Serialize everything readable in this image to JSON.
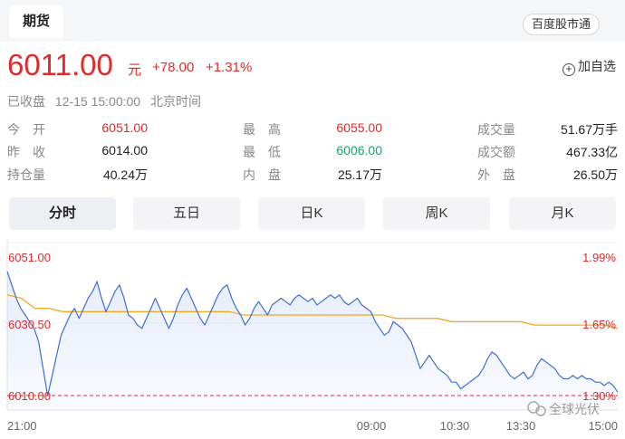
{
  "header": {
    "tab_label": "期货",
    "brand_button": "百度股市通"
  },
  "quote": {
    "price": "6011.00",
    "unit": "元",
    "change": "+78.00",
    "change_pct": "+1.31%",
    "watch_label": "加自选",
    "status": "已收盘",
    "time": "12-15 15:00:00",
    "timezone": "北京时间"
  },
  "stats": {
    "open_label": "今　开",
    "open": "6051.00",
    "prev_close_label": "昨　收",
    "prev_close": "6014.00",
    "open_interest_label": "持仓量",
    "open_interest": "40.24万",
    "high_label": "最　高",
    "high": "6055.00",
    "low_label": "最　低",
    "low": "6006.00",
    "inner_label": "内　盘",
    "inner": "25.17万",
    "volume_label": "成交量",
    "volume": "51.67万手",
    "amount_label": "成交额",
    "amount": "467.33亿",
    "outer_label": "外　盘",
    "outer": "26.50万"
  },
  "period_tabs": [
    "分时",
    "五日",
    "日K",
    "周K",
    "月K"
  ],
  "colors": {
    "up": "#e22a2a",
    "down": "#1aa36b",
    "price_line": "#3b6fd8",
    "avg_line": "#f5a623"
  },
  "watermark": "全球光伏",
  "chart_data": {
    "type": "line",
    "y_labels": [
      "6051.00",
      "6030.50",
      "6010.00"
    ],
    "pct_labels": [
      "1.99%",
      "1.65%",
      "1.30%"
    ],
    "x_labels": [
      "21:00",
      "09:00",
      "10:30",
      "13:30",
      "15:00"
    ],
    "ylim": [
      6010,
      6051
    ],
    "series": [
      {
        "values": [
          6047,
          6043,
          6039,
          6036,
          6034,
          6032,
          6030,
          6026,
          6018,
          6010,
          6016,
          6022,
          6028,
          6031,
          6034,
          6036,
          6033,
          6036,
          6039,
          6041,
          6044,
          6039,
          6035,
          6038,
          6041,
          6043,
          6039,
          6034,
          6033,
          6031,
          6030,
          6033,
          6036,
          6039,
          6036,
          6033,
          6030,
          6033,
          6037,
          6040,
          6042,
          6039,
          6036,
          6033,
          6031,
          6034,
          6037,
          6040,
          6042,
          6043,
          6039,
          6036,
          6034,
          6031,
          6033,
          6036,
          6038,
          6036,
          6034,
          6037,
          6038,
          6039,
          6038,
          6037,
          6039,
          6040,
          6039,
          6038,
          6039,
          6037,
          6038,
          6039,
          6040,
          6039,
          6040,
          6038,
          6037,
          6038,
          6039,
          6037,
          6036,
          6035,
          6032,
          6030,
          6028,
          6029,
          6032,
          6031,
          6030,
          6028,
          6026,
          6022,
          6018,
          6020,
          6022,
          6020,
          6018,
          6017,
          6016,
          6014,
          6014,
          6012,
          6013,
          6014,
          6015,
          6016,
          6018,
          6021,
          6023,
          6022,
          6020,
          6018,
          6016,
          6015,
          6016,
          6017,
          6015,
          6016,
          6019,
          6021,
          6020,
          6019,
          6018,
          6016,
          6015,
          6015,
          6016,
          6015,
          6016,
          6015,
          6015,
          6014,
          6014,
          6013,
          6014,
          6013,
          6011
        ]
      },
      {
        "values": [
          6040,
          6039,
          6036,
          6036,
          6035,
          6035,
          6035,
          6035,
          6035,
          6035,
          6035,
          6035,
          6035,
          6035,
          6035,
          6035,
          6035,
          6034,
          6034,
          6034,
          6034,
          6034,
          6034,
          6034,
          6034,
          6034,
          6034,
          6034,
          6033,
          6033,
          6033,
          6033,
          6032,
          6032,
          6032,
          6032,
          6032,
          6032,
          6031,
          6031,
          6031,
          6031,
          6031,
          6031,
          6030
        ]
      }
    ]
  }
}
